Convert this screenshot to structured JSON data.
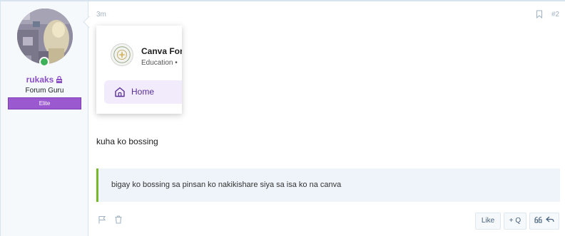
{
  "post": {
    "user": {
      "username": "rukaks",
      "title": "Forum Guru",
      "banner": "Elite",
      "avatar_icon": "avatar-image",
      "online_icon": "online-indicator-icon",
      "username_icon": "lock-icon"
    },
    "time": "3m",
    "post_number": "#2",
    "embed": {
      "group_name": "Canva For",
      "group_meta": "Education •",
      "nav_home": "Home",
      "home_icon": "home-icon"
    },
    "message": "kuha ko bossing",
    "quote": "bigay ko bossing sa pinsan ko nakikishare siya sa isa ko na canva",
    "actions": {
      "like": "Like",
      "quote": "Q",
      "report_icon": "flag-icon",
      "delete_icon": "trash-icon",
      "multiquote_icon": "quote-marks-icon",
      "reply_icon": "reply-icon",
      "bookmark_icon": "bookmark-icon"
    },
    "colors": {
      "accent": "#8b4fc7",
      "banner": "#9b59d0",
      "quote_border": "#76b82a",
      "online": "#3db158"
    }
  }
}
